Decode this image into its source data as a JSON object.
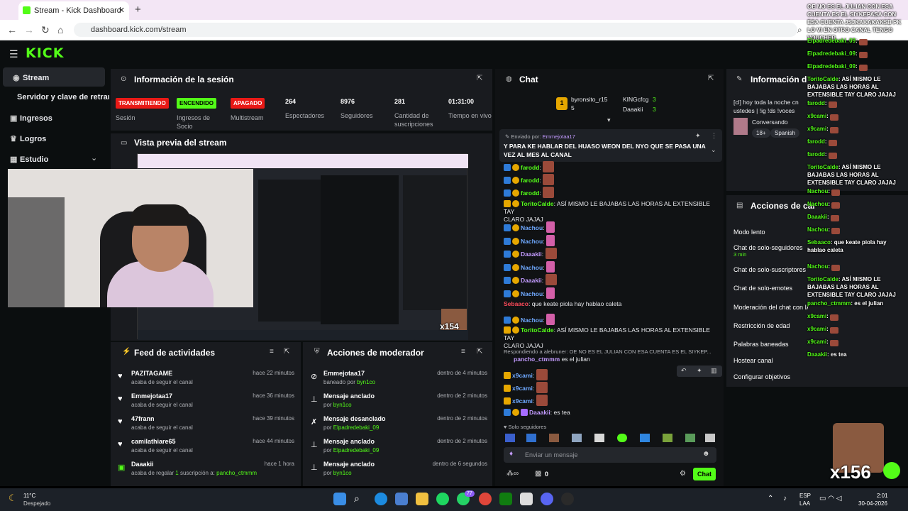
{
  "browser": {
    "tab_title": "Stream - Kick Dashboard",
    "url": "dashboard.kick.com/stream"
  },
  "sidebar": {
    "items": [
      {
        "label": "Stream"
      },
      {
        "label": "Servidor y clave de retransm"
      },
      {
        "label": "Ingresos"
      },
      {
        "label": "Logros"
      },
      {
        "label": "Estudio"
      }
    ]
  },
  "session": {
    "title": "Información de la sesión",
    "badges": [
      {
        "text": "TRANSMITIENDO",
        "label": "Sesión",
        "color": "#e91916"
      },
      {
        "text": "ENCENDIDO",
        "label": "Ingresos de Socio",
        "color": "#53fc18"
      },
      {
        "text": "APAGADO",
        "label": "Multistream",
        "color": "#e91916"
      }
    ],
    "stats": [
      {
        "value": "264",
        "label": "Espectadores"
      },
      {
        "value": "8976",
        "label": "Seguidores"
      },
      {
        "value": "281",
        "label": "Cantidad de suscripciones"
      },
      {
        "value": "01:31:00",
        "label": "Tiempo en vivo"
      }
    ]
  },
  "preview": {
    "title": "Vista previa del stream",
    "overlay_count": "x154"
  },
  "feed": {
    "title": "Feed de actividades",
    "items": [
      {
        "name": "PAZITAGAME",
        "sub": "acaba de seguir el canal",
        "time": "hace 22 minutos"
      },
      {
        "name": "Emmejotaa17",
        "sub": "acaba de seguir el canal",
        "time": "hace 36 minutos"
      },
      {
        "name": "47frann",
        "sub": "acaba de seguir el canal",
        "time": "hace 39 minutos"
      },
      {
        "name": "camilathiare65",
        "sub": "acaba de seguir el canal",
        "time": "hace 44 minutos"
      },
      {
        "name": "Daaakii",
        "sub": "acaba de regalar",
        "count": "1",
        "sub2": "suscripción a:",
        "target": "pancho_ctmmm",
        "time": "hace 1 hora"
      }
    ]
  },
  "mod": {
    "title": "Acciones de moderador",
    "items": [
      {
        "name": "Emmejotaa17",
        "sub": "baneado por",
        "by": "byn1co",
        "time": "dentro de 4 minutos"
      },
      {
        "name": "Mensaje anclado",
        "sub": "por",
        "by": "byn1co",
        "time": "dentro de 2 minutos"
      },
      {
        "name": "Mensaje desanclado",
        "sub": "por",
        "by": "Elpadredebaki_09",
        "time": "dentro de 2 minutos"
      },
      {
        "name": "Mensaje anclado",
        "sub": "por",
        "by": "Elpadredebaki_09",
        "time": "dentro de 2 minutos"
      },
      {
        "name": "Mensaje anclado",
        "sub": "por",
        "by": "byn1co",
        "time": "dentro de 6 segundos"
      }
    ]
  },
  "chat": {
    "title": "Chat",
    "top": [
      {
        "name": "byronsito_r15",
        "count": "5"
      },
      {
        "name": "KINGcfcg",
        "count": "3"
      },
      {
        "name": "Daaakii",
        "count": "3"
      }
    ],
    "pinned_by_prefix": "Enviado por:",
    "pinned_by": "Emmejotaa17",
    "pinned_text": "Y PARA KE HABLAR DEL HUASO WEON DEL NYO QUE SE PASA UNA VEZ AL MES AL CANAL",
    "messages": [
      {
        "user": "farodd",
        "text": "",
        "color": "#53fc18",
        "emote": true
      },
      {
        "user": "farodd",
        "text": "",
        "color": "#53fc18",
        "emote": true
      },
      {
        "user": "farodd",
        "text": "",
        "color": "#53fc18",
        "emote": true
      },
      {
        "user": "ToritoCalde",
        "text": "ASÍ MISMO LE BAJABAS LAS HORAS AL EXTENSIBLE TAY",
        "text2": "CLARO JAJAJ",
        "color": "#53fc18"
      },
      {
        "user": "Nachou",
        "text": "",
        "color": "#6fa9ff",
        "emote": "pink"
      },
      {
        "user": "Nachou",
        "text": "",
        "color": "#6fa9ff",
        "emote": "pink"
      },
      {
        "user": "Daaakii",
        "text": "",
        "color": "#c39bff",
        "emote": true
      },
      {
        "user": "Nachou",
        "text": "",
        "color": "#6fa9ff",
        "emote": "pink"
      },
      {
        "user": "Daaakii",
        "text": "",
        "color": "#c39bff",
        "emote": true
      },
      {
        "user": "Nachou",
        "text": "",
        "color": "#6fa9ff",
        "emote": "pink"
      },
      {
        "user": "Sebaaco",
        "text": "que keate piola hay hablao caleta",
        "color": "#ff4a5a"
      },
      {
        "user": "Nachou",
        "text": "",
        "color": "#6fa9ff",
        "emote": "pink"
      },
      {
        "user": "ToritoCalde",
        "text": "ASÍ MISMO LE BAJABAS LAS HORAS AL EXTENSIBLE TAY",
        "text2": "CLARO JAJAJ",
        "color": "#53fc18"
      }
    ],
    "reply_to": "Respondiendo a alebruner: OE NO ES EL JULIAN CON ESA CUENTA ES EL SIYKEP...",
    "reply_user": "pancho_ctmmm",
    "reply_text": "es el julian",
    "messages2": [
      {
        "user": "x9cami"
      },
      {
        "user": "x9cami"
      },
      {
        "user": "x9cami"
      }
    ],
    "last_user": "Daaakii",
    "last_text": "es tea",
    "followers_only": "Solo seguidores",
    "input_placeholder": "Enviar un mensaje",
    "points": "0",
    "send": "Chat"
  },
  "info": {
    "title": "Información del stream",
    "stream_title": "[cl] hoy toda la noche cn ustedes | !ig !ds !voces",
    "category": "Conversando",
    "tags": [
      "18+",
      "Spanish"
    ]
  },
  "channel_actions": {
    "title": "Acciones de canal",
    "items": [
      "Modo lento",
      "Chat de solo-seguidores",
      "Chat de solo-suscriptores",
      "Chat de solo-emotes",
      "Moderación del chat con IA",
      "Restricción de edad",
      "Palabras baneadas",
      "Hostear canal",
      "Configurar objetivos"
    ],
    "followers_note": "3 min"
  },
  "overlay": {
    "lines": [
      {
        "u": "",
        "t": "OE NO ES EL JULIAN CON ESA CUENTA ES EL SIYKEPASA CON ESA CUENTA JSJKAKAKAKSB PK LO VI EN OTRO CANAL TENGO VOUCHER"
      },
      {
        "u": "Elpadredebaki_09",
        "t": ""
      },
      {
        "u": "Elpadredebaki_09",
        "t": ""
      },
      {
        "u": "Elpadredebaki_09",
        "t": ""
      },
      {
        "u": "ToritoCalde",
        "t": "ASÍ MISMO LE BAJABAS LAS HORAS AL EXTENSIBLE TAY CLARO JAJAJ"
      },
      {
        "u": "farodd",
        "t": ""
      },
      {
        "u": "x9cami",
        "t": ""
      },
      {
        "u": "x9cami",
        "t": ""
      },
      {
        "u": "farodd",
        "t": ""
      },
      {
        "u": "farodd",
        "t": ""
      },
      {
        "u": "ToritoCalde",
        "t": "ASÍ MISMO LE BAJABAS LAS HORAS AL EXTENSIBLE TAY CLARO JAJAJ"
      },
      {
        "u": "Nachou",
        "t": ""
      },
      {
        "u": "Nachou",
        "t": ""
      },
      {
        "u": "Daaakii",
        "t": ""
      },
      {
        "u": "Nachou",
        "t": ""
      },
      {
        "u": "Sebaaco",
        "t": "que keate piola hay hablao caleta"
      },
      {
        "u": "Nachou",
        "t": ""
      },
      {
        "u": "ToritoCalde",
        "t": "ASÍ MISMO LE BAJABAS LAS HORAS AL EXTENSIBLE TAY CLARO JAJAJ"
      },
      {
        "u": "pancho_ctmmm",
        "t": "es el julian"
      },
      {
        "u": "x9cami",
        "t": ""
      },
      {
        "u": "x9cami",
        "t": ""
      },
      {
        "u": "x9cami",
        "t": ""
      },
      {
        "u": "Daaakii",
        "t": "es tea"
      }
    ],
    "count": "x156"
  },
  "taskbar": {
    "temp": "11°C",
    "weather": "Despejado",
    "lang1": "ESP",
    "lang2": "LAA",
    "time": "2:01",
    "date": "30-04-2026",
    "badge": "77"
  }
}
